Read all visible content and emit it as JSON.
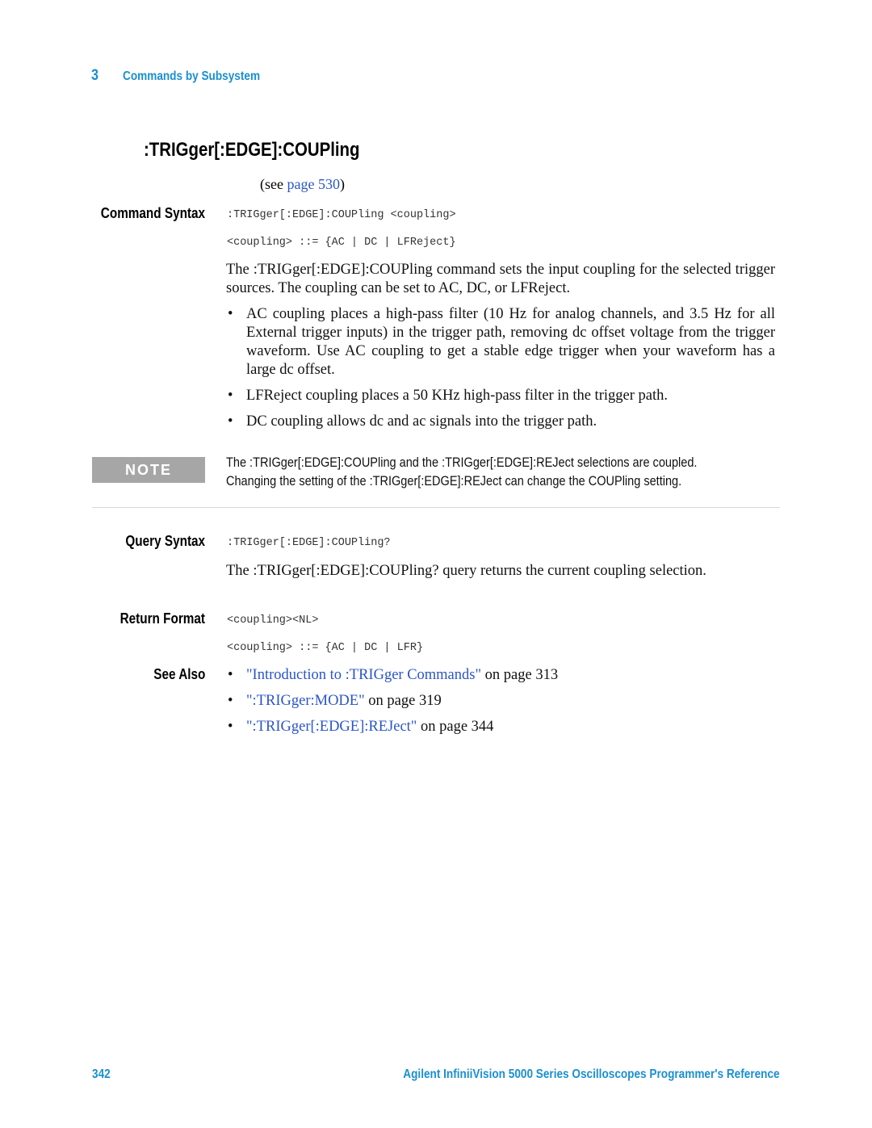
{
  "header": {
    "chapter_number": "3",
    "chapter_title": "Commands by Subsystem"
  },
  "section": {
    "title": ":TRIGger[:EDGE]:COUPling",
    "see_prefix": "(see ",
    "see_link": "page 530",
    "see_suffix": ")"
  },
  "command_syntax": {
    "label": "Command Syntax",
    "lines": [
      ":TRIGger[:EDGE]:COUPling <coupling>",
      "<coupling> ::= {AC | DC | LFReject}"
    ]
  },
  "description": {
    "paragraph": "The :TRIGger[:EDGE]:COUPling command sets the input coupling for the selected trigger sources. The coupling can be set to AC, DC, or LFReject.",
    "bullets": [
      "AC coupling places a high-pass filter (10 Hz for analog channels, and 3.5 Hz for all External trigger inputs) in the trigger path, removing dc offset voltage from the trigger waveform. Use AC coupling to get a stable edge trigger when your waveform has a large dc offset.",
      "LFReject coupling places a 50 KHz high-pass filter in the trigger path.",
      "DC coupling allows dc and ac signals into the trigger path."
    ]
  },
  "note": {
    "badge": "NOTE",
    "lines": [
      "The :TRIGger[:EDGE]:COUPling and the :TRIGger[:EDGE]:REJect selections are coupled.",
      "Changing the setting of the :TRIGger[:EDGE]:REJect can change the COUPling setting."
    ]
  },
  "query_syntax": {
    "label": "Query Syntax",
    "code": ":TRIGger[:EDGE]:COUPling?",
    "paragraph": "The :TRIGger[:EDGE]:COUPling? query returns the current coupling selection."
  },
  "return_format": {
    "label": "Return Format",
    "lines": [
      "<coupling><NL>",
      "<coupling> ::= {AC | DC | LFR}"
    ]
  },
  "see_also": {
    "label": "See Also",
    "items": [
      {
        "link": "\"Introduction to :TRIGger Commands\"",
        "suffix": " on page 313"
      },
      {
        "link": "\":TRIGger:MODE\"",
        "suffix": " on page 319"
      },
      {
        "link": "\":TRIGger[:EDGE]:REJect\"",
        "suffix": " on page 344"
      }
    ]
  },
  "footer": {
    "page_number": "342",
    "book_title": "Agilent InfiniiVision 5000 Series Oscilloscopes Programmer's Reference"
  },
  "colors": {
    "accent": "#1a8fd0",
    "link": "#2a55c8",
    "note_badge": "#a6a6a6"
  }
}
